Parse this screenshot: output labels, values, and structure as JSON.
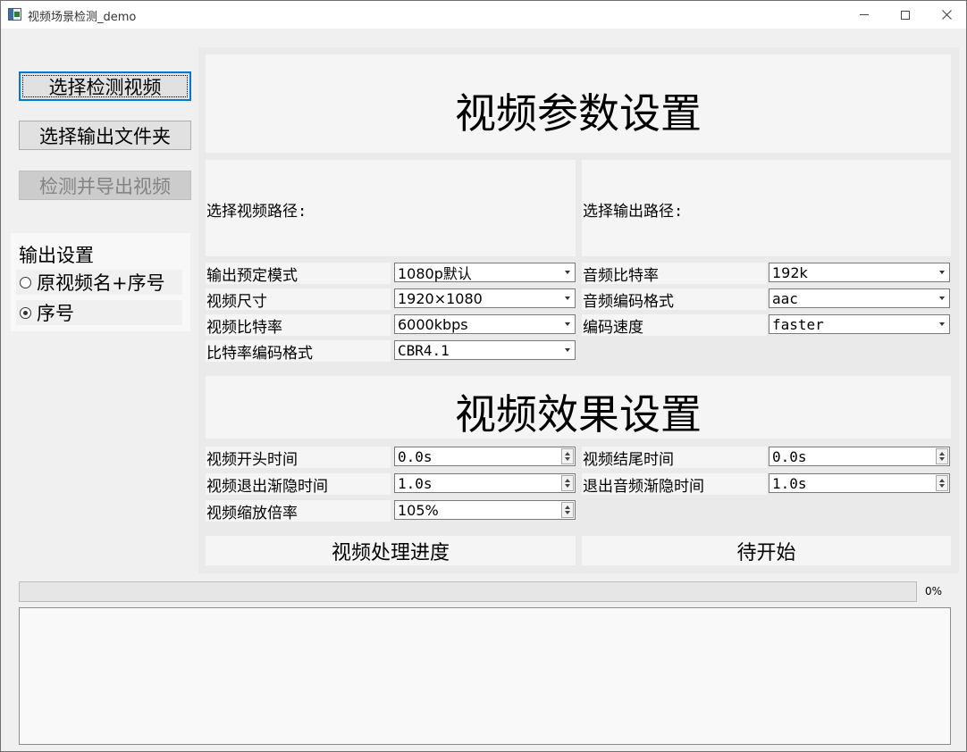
{
  "window": {
    "title": "视频场景检测_demo"
  },
  "sidebar": {
    "select_video_button": "选择检测视频",
    "select_output_folder_button": "选择输出文件夹",
    "detect_export_button": "检测并导出视频",
    "output_settings": {
      "title": "输出设置",
      "options": [
        {
          "label": "原视频名+序号",
          "checked": false
        },
        {
          "label": "序号",
          "checked": true
        }
      ]
    }
  },
  "video_params": {
    "title": "视频参数设置",
    "input_path_label": "选择视频路径:",
    "output_path_label": "选择输出路径:",
    "left_fields": [
      {
        "label": "输出预定模式",
        "value": "1080p默认"
      },
      {
        "label": "视频尺寸",
        "value": "1920×1080"
      },
      {
        "label": "视频比特率",
        "value": "6000kbps"
      },
      {
        "label": "比特率编码格式",
        "value": "CBR4.1"
      }
    ],
    "right_fields": [
      {
        "label": "音频比特率",
        "value": "192k"
      },
      {
        "label": "音频编码格式",
        "value": "aac"
      },
      {
        "label": "编码速度",
        "value": "faster"
      }
    ]
  },
  "video_effects": {
    "title": "视频效果设置",
    "left_fields": [
      {
        "label": "视频开头时间",
        "value": "0.0s"
      },
      {
        "label": "视频退出渐隐时间",
        "value": "1.0s"
      },
      {
        "label": "视频缩放倍率",
        "value": "105%"
      }
    ],
    "right_fields": [
      {
        "label": "视频结尾时间",
        "value": "0.0s"
      },
      {
        "label": "退出音频渐隐时间",
        "value": "1.0s"
      }
    ]
  },
  "progress": {
    "label": "视频处理进度",
    "status": "待开始",
    "percent_text": "0%",
    "fraction": 0
  },
  "log": {
    "text": ""
  }
}
